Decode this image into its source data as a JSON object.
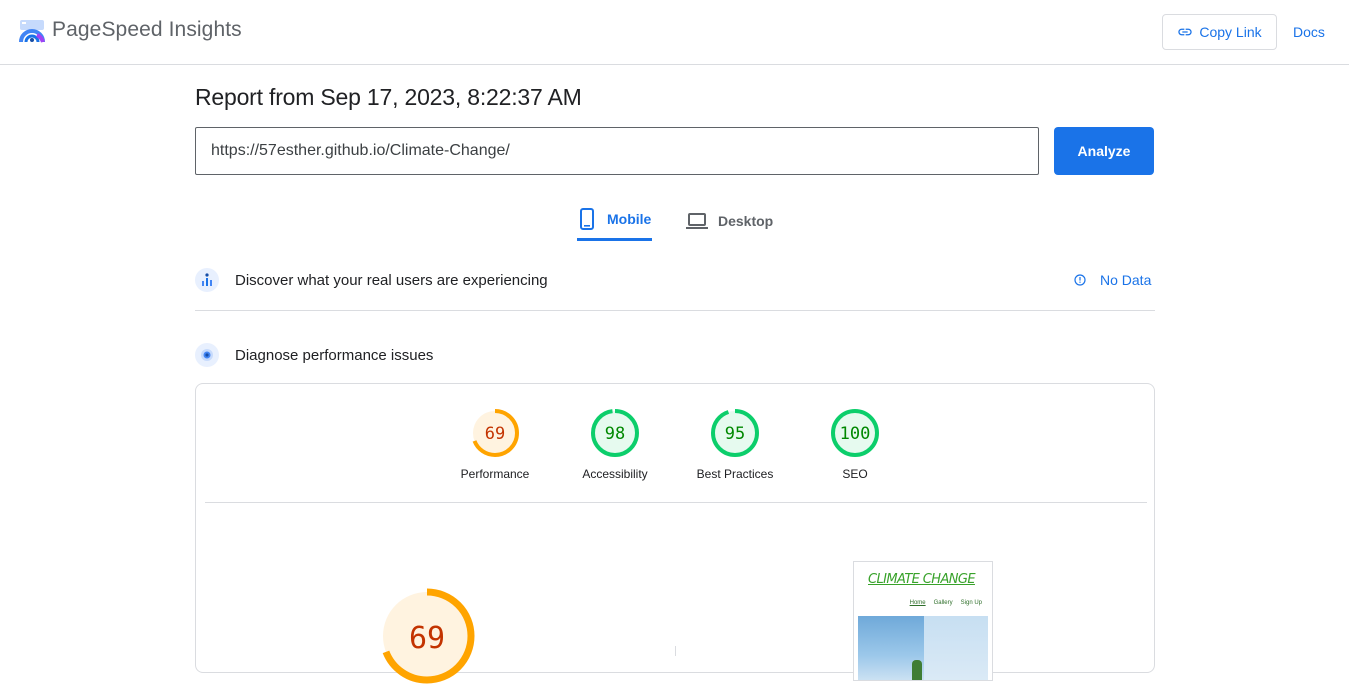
{
  "header": {
    "brand": "PageSpeed Insights",
    "copy_link_label": "Copy Link",
    "docs_label": "Docs"
  },
  "report": {
    "title": "Report from Sep 17, 2023, 8:22:37 AM",
    "url_value": "https://57esther.github.io/Climate-Change/",
    "analyze_label": "Analyze"
  },
  "tabs": [
    {
      "label": "Mobile",
      "active": true
    },
    {
      "label": "Desktop",
      "active": false
    }
  ],
  "field_data": {
    "title": "Discover what your real users are experiencing",
    "status": "No Data"
  },
  "lab_data": {
    "title": "Diagnose performance issues"
  },
  "scores": [
    {
      "label": "Performance",
      "value": "69",
      "color": "#ffa400",
      "text_color": "#c33300",
      "bg": "#fff3e0"
    },
    {
      "label": "Accessibility",
      "value": "98",
      "color": "#0cce6b",
      "text_color": "#008800",
      "bg": "#e6faef"
    },
    {
      "label": "Best Practices",
      "value": "95",
      "color": "#0cce6b",
      "text_color": "#008800",
      "bg": "#e6faef"
    },
    {
      "label": "SEO",
      "value": "100",
      "color": "#0cce6b",
      "text_color": "#008800",
      "bg": "#e6faef"
    }
  ],
  "main_score": {
    "value": "69"
  },
  "thumbnail": {
    "title": "CLIMATE CHANGE",
    "nav": [
      "Home",
      "Gallery",
      "Sign Up"
    ]
  },
  "colors": {
    "accent": "#1a73e8",
    "average": "#ffa400",
    "pass": "#0cce6b"
  }
}
